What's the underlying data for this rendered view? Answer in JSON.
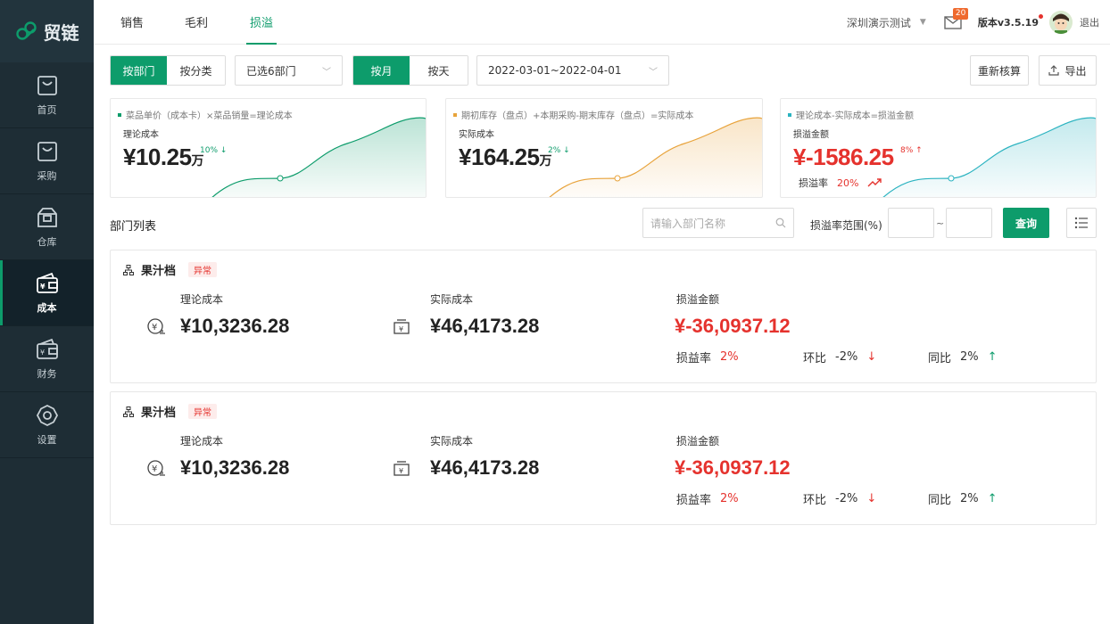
{
  "app": {
    "brand_name": "贸链",
    "brand_color": "#0d9c6b"
  },
  "sidebar": {
    "items": [
      {
        "label": "首页",
        "icon": "home-icon"
      },
      {
        "label": "采购",
        "icon": "purchase-icon"
      },
      {
        "label": "仓库",
        "icon": "warehouse-icon"
      },
      {
        "label": "成本",
        "icon": "cost-icon",
        "active": true
      },
      {
        "label": "财务",
        "icon": "finance-icon"
      },
      {
        "label": "设置",
        "icon": "gear-icon"
      }
    ]
  },
  "header": {
    "tabs": [
      "销售",
      "毛利",
      "损溢"
    ],
    "active_tab": "损溢",
    "store": "深圳演示测试",
    "mail_badge": "20",
    "version": "版本v3.5.19",
    "logout": "退出"
  },
  "toolbar": {
    "group_by": [
      "按部门",
      "按分类"
    ],
    "dept_select": "已选6部门",
    "period": [
      "按月",
      "按天"
    ],
    "date_range": "2022-03-01~2022-04-01",
    "recalc_label": "重新核算",
    "export_label": "导出"
  },
  "cards": [
    {
      "formula": "菜品单价（成本卡）×菜品销量=理论成本",
      "label": "理论成本",
      "value": "¥10.25",
      "unit": "万",
      "pct": "10%",
      "trend": "down",
      "color": "#0d9c6b"
    },
    {
      "formula": "期初库存（盘点）+本期采购-期末库存（盘点）=实际成本",
      "label": "实际成本",
      "value": "¥164.25",
      "unit": "万",
      "pct": "2%",
      "trend": "down",
      "color": "#e8a33b"
    },
    {
      "formula": "理论成本-实际成本=损溢金额",
      "label": "损溢金额",
      "value": "¥-1586.25",
      "unit": "",
      "pct": "8%",
      "trend": "up",
      "rate_label": "损溢率",
      "rate_value": "20%",
      "color": "#2bb3c0"
    }
  ],
  "list": {
    "title": "部门列表",
    "search_placeholder": "请输入部门名称",
    "range_label": "损溢率范围(%)",
    "tilde": "~",
    "query_label": "查询"
  },
  "departments": [
    {
      "name": "果汁档",
      "tag": "异常",
      "theory_label": "理论成本",
      "theory_value": "¥10,3236.28",
      "actual_label": "实际成本",
      "actual_value": "¥46,4173.28",
      "diff_label": "损溢金额",
      "diff_value": "¥-36,0937.12",
      "rate_label": "损益率",
      "rate_value": "2%",
      "mom_label": "环比",
      "mom_value": "-2%",
      "yoy_label": "同比",
      "yoy_value": "2%"
    },
    {
      "name": "果汁档",
      "tag": "异常",
      "theory_label": "理论成本",
      "theory_value": "¥10,3236.28",
      "actual_label": "实际成本",
      "actual_value": "¥46,4173.28",
      "diff_label": "损溢金额",
      "diff_value": "¥-36,0937.12",
      "rate_label": "损益率",
      "rate_value": "2%",
      "mom_label": "环比",
      "mom_value": "-2%",
      "yoy_label": "同比",
      "yoy_value": "2%"
    }
  ]
}
